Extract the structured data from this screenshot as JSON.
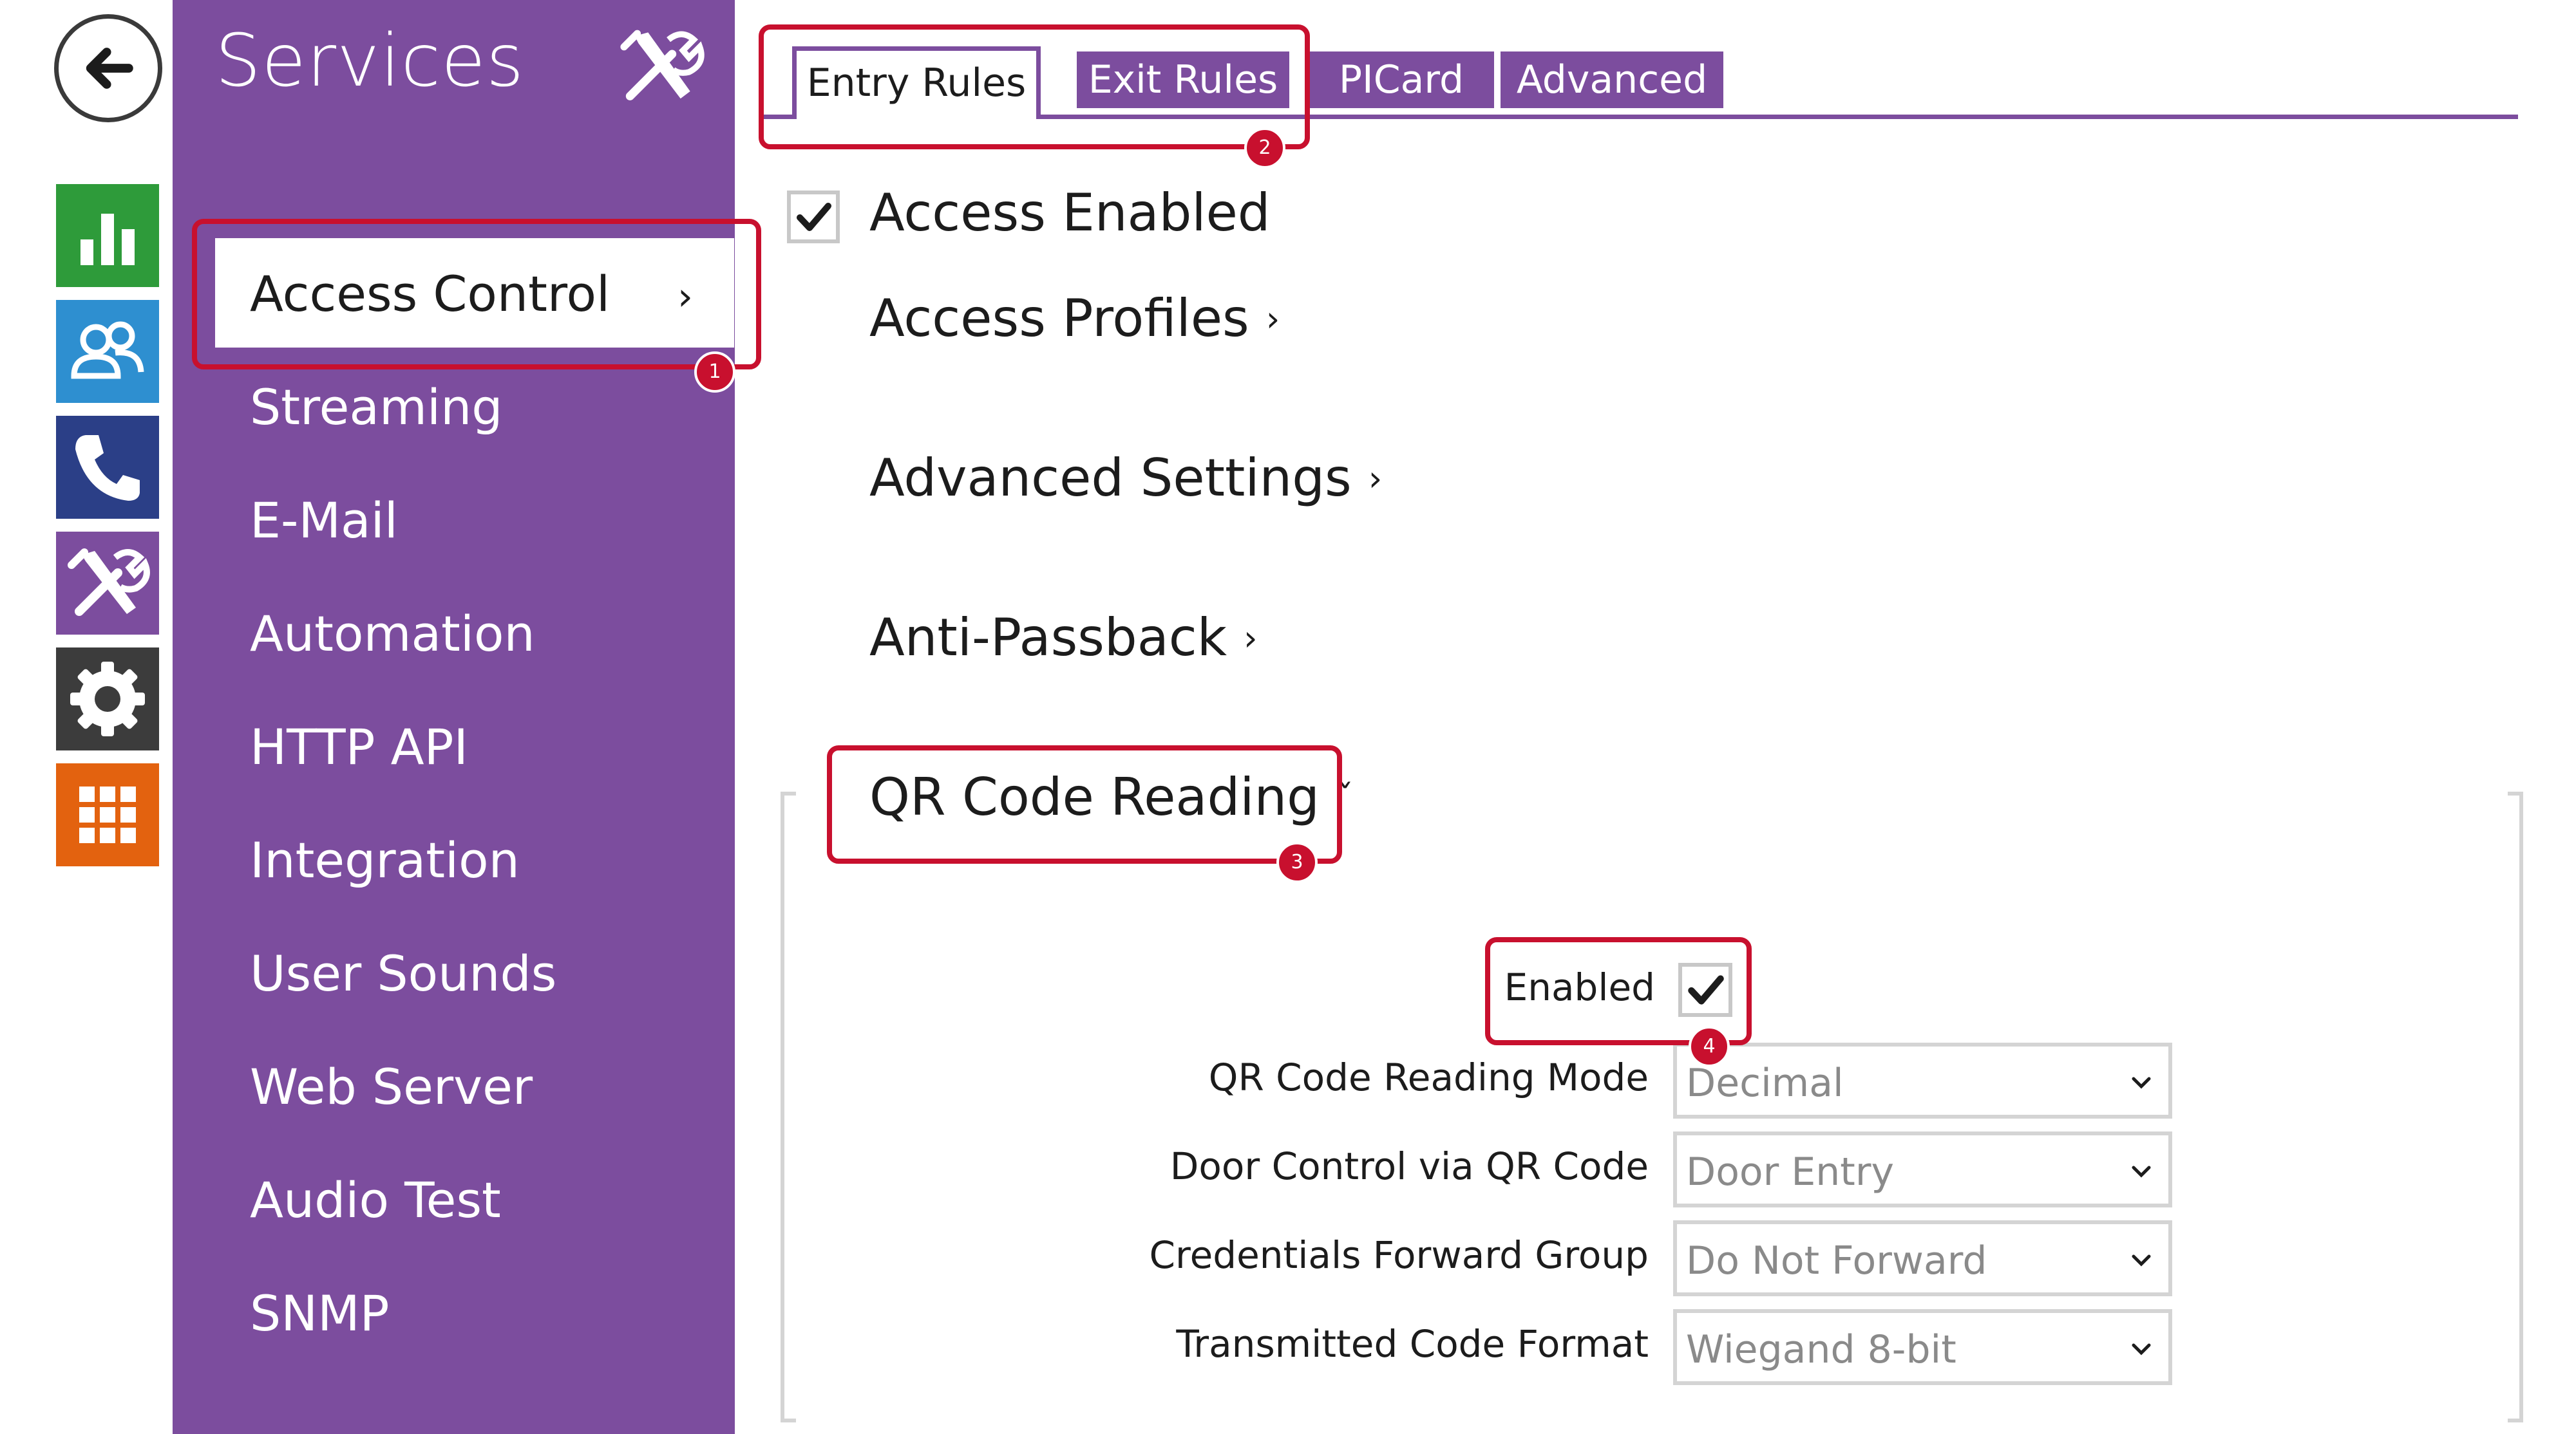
{
  "rail": {
    "back_icon": "arrow-left-icon",
    "items": [
      {
        "icon": "bar-chart-icon",
        "color": "#2e9b3a"
      },
      {
        "icon": "users-icon",
        "color": "#2e8fd0"
      },
      {
        "icon": "phone-icon",
        "color": "#2b3f87"
      },
      {
        "icon": "tools-icon",
        "color": "#7c4d9e"
      },
      {
        "icon": "gear-icon",
        "color": "#3c3c3c"
      },
      {
        "icon": "grid-icon",
        "color": "#e3620f"
      }
    ]
  },
  "services": {
    "title": "Services",
    "header_icon": "tools-icon",
    "active_item": "Access Control",
    "items": [
      "Streaming",
      "E-Mail",
      "Automation",
      "HTTP API",
      "Integration",
      "User Sounds",
      "Web Server",
      "Audio Test",
      "SNMP"
    ]
  },
  "tabs": [
    "Entry Rules",
    "Exit Rules",
    "PICard",
    "Advanced"
  ],
  "content": {
    "access_enabled_label": "Access Enabled",
    "access_enabled_checked": true,
    "access_profiles": "Access Profiles",
    "advanced_settings": "Advanced Settings",
    "anti_passback": "Anti-Passback",
    "qr_code_reading": "QR Code Reading"
  },
  "qr_form": {
    "enabled_label": "Enabled",
    "enabled_checked": true,
    "fields": [
      {
        "label": "QR Code Reading Mode",
        "value": "Decimal"
      },
      {
        "label": "Door Control via QR Code",
        "value": "Door Entry"
      },
      {
        "label": "Credentials Forward Group",
        "value": "Do Not Forward"
      },
      {
        "label": "Transmitted Code Format",
        "value": "Wiegand 8-bit"
      }
    ]
  },
  "annotations": [
    "1",
    "2",
    "3",
    "4"
  ],
  "colors": {
    "accent": "#7c4d9e",
    "callout": "#c8102e"
  }
}
